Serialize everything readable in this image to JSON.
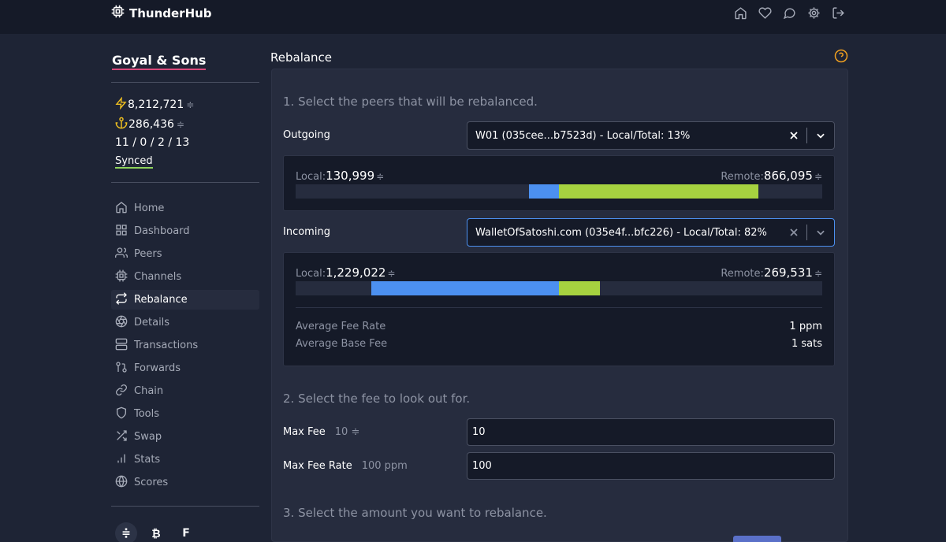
{
  "app": {
    "brand": "ThunderHub"
  },
  "nav_icons": [
    "home-icon",
    "heart-icon",
    "chat-icon",
    "gear-icon",
    "logout-icon"
  ],
  "sidebar": {
    "node_name": "Goyal & Sons",
    "lightning_balance": "8,212,721",
    "onchain_balance": "286,436",
    "channel_counts": "11 / 0 / 2 / 13",
    "sync_status": "Synced",
    "menu": [
      {
        "label": "Home",
        "icon": "home-icon"
      },
      {
        "label": "Dashboard",
        "icon": "grid-icon"
      },
      {
        "label": "Peers",
        "icon": "users-icon"
      },
      {
        "label": "Channels",
        "icon": "cpu-icon"
      },
      {
        "label": "Rebalance",
        "icon": "repeat-icon",
        "active": true
      },
      {
        "label": "Details",
        "icon": "aperture-icon"
      },
      {
        "label": "Transactions",
        "icon": "server-icon"
      },
      {
        "label": "Forwards",
        "icon": "git-pull-request-icon"
      },
      {
        "label": "Chain",
        "icon": "link-icon"
      },
      {
        "label": "Tools",
        "icon": "shield-icon"
      },
      {
        "label": "Swap",
        "icon": "shuffle-icon"
      },
      {
        "label": "Stats",
        "icon": "bar-chart-icon"
      },
      {
        "label": "Scores",
        "icon": "globe-icon"
      }
    ],
    "currency_toggle": [
      "≑",
      "₿",
      "F"
    ]
  },
  "sat_symbol": "≑",
  "page": {
    "title": "Rebalance",
    "step1": "1. Select the peers that will be rebalanced.",
    "step2": "2. Select the fee to look out for.",
    "step3": "3. Select the amount you want to rebalance.",
    "outgoing": {
      "label": "Outgoing",
      "selected": "W01 (035cee...b7523d) - Local/Total: 13%",
      "local_label": "Local:",
      "local_value": "130,999",
      "remote_label": "Remote:",
      "remote_value": "866,095",
      "local_fraction": 0.13,
      "remote_fraction": 0.87
    },
    "incoming": {
      "label": "Incoming",
      "selected": "WalletOfSatoshi.com (035e4f...bfc226) - Local/Total: 82%",
      "local_label": "Local:",
      "local_value": "1,229,022",
      "remote_label": "Remote:",
      "remote_value": "269,531",
      "local_fraction": 0.82,
      "remote_fraction": 0.18,
      "avg_fee_rate_label": "Average Fee Rate",
      "avg_fee_rate": "1 ppm",
      "avg_base_fee_label": "Average Base Fee",
      "avg_base_fee": "1 sats"
    },
    "max_fee": {
      "label": "Max Fee",
      "hint": "10",
      "value": "10"
    },
    "max_fee_rate": {
      "label": "Max Fee Rate",
      "hint": "100 ppm",
      "value": "100"
    }
  },
  "colors": {
    "local": "#4c90f0",
    "remote": "#a6d240",
    "accent": "#d9487a",
    "synced": "#8ed25a",
    "help": "#f0a020"
  }
}
